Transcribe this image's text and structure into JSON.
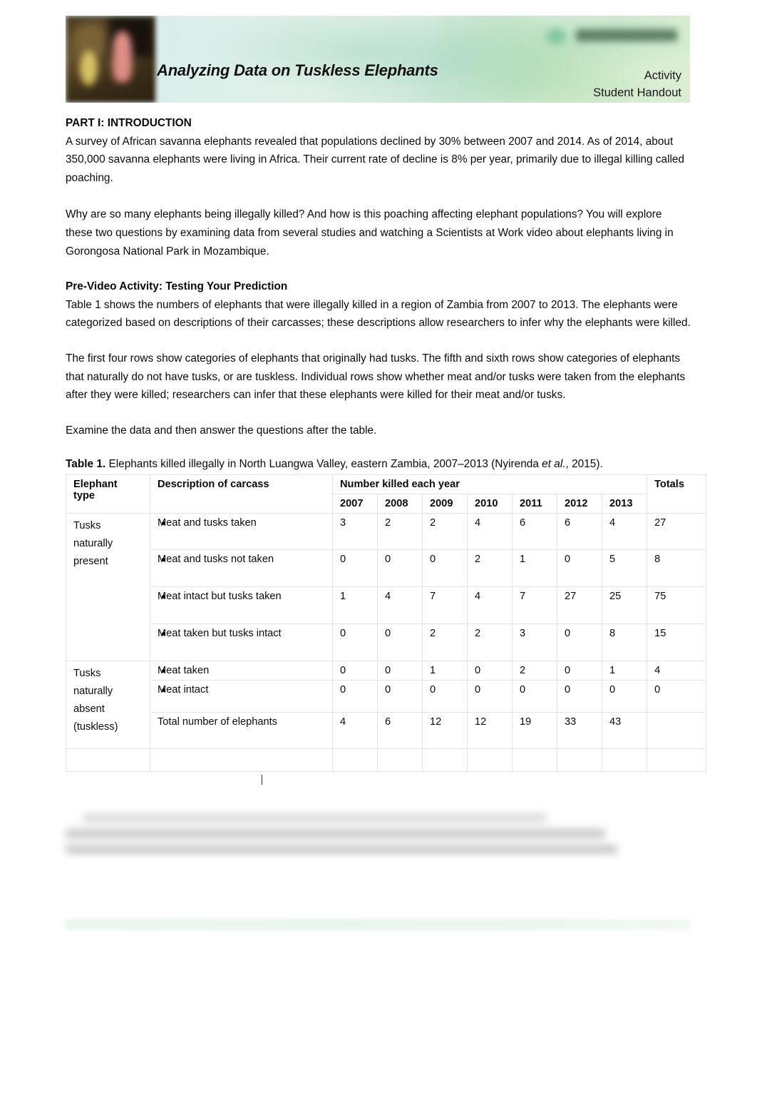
{
  "header": {
    "title": "Analyzing Data on Tuskless Elephants",
    "doc_type": "Activity",
    "audience": "Student Handout",
    "logo_alt": "gorongosa-logo",
    "banner_color": "#d9eee0"
  },
  "sections": {
    "part1_heading": "PART I: INTRODUCTION",
    "para1": "A survey of African savanna elephants revealed that populations declined by 30% between 2007 and 2014. As of 2014, about 350,000 savanna elephants were living in Africa. Their current rate of decline is 8% per year, primarily due to illegal killing called poaching.",
    "para2": "Why are so many elephants being illegally killed? And how is this poaching affecting elephant populations? You will explore these two questions by examining data from several studies and watching a Scientists at Work video about elephants living in Gorongosa National Park in Mozambique.",
    "prevideo_heading": "Pre-Video Activity: Testing Your Prediction",
    "para3": "Table 1 shows the numbers of elephants that were illegally killed in a region of Zambia from 2007 to 2013. The elephants were categorized based on descriptions of their carcasses; these descriptions allow researchers to infer why the elephants were killed.",
    "para4": "The first four rows show categories of elephants that originally had tusks. The fifth and sixth rows show categories of elephants that naturally do not have tusks, or are tuskless. Individual rows show whether meat and/or tusks were taken from the elephants after they were killed; researchers can infer that these elephants were killed for their meat and/or tusks.",
    "para5": "Examine the data and then answer the questions after the table."
  },
  "table": {
    "caption_label": "Table 1.",
    "caption_text_a": " Elephants killed illegally in North Luangwa Valley, eastern Zambia, 2007–2013 (Nyirenda ",
    "caption_italic": "et al.",
    "caption_text_b": ", 2015).",
    "headers": {
      "elephant_type_line1": "Elephant",
      "elephant_type_line2": "type",
      "description": "Description of carcass",
      "number_killed": "Number killed each year",
      "totals": "Totals",
      "years": [
        "2007",
        "2008",
        "2009",
        "2010",
        "2011",
        "2012",
        "2013"
      ]
    },
    "groups": [
      {
        "type_label_lines": [
          "Tusks",
          "naturally",
          "present"
        ],
        "rows": [
          {
            "description": "Meat and tusks taken",
            "values": [
              "3",
              "2",
              "2",
              "4",
              "6",
              "6",
              "4"
            ],
            "total": "27"
          },
          {
            "description": "Meat and tusks not taken",
            "values": [
              "0",
              "0",
              "0",
              "2",
              "1",
              "0",
              "5"
            ],
            "total": "8"
          },
          {
            "description": "Meat intact but tusks taken",
            "values": [
              "1",
              "4",
              "7",
              "4",
              "7",
              "27",
              "25"
            ],
            "total": "75"
          },
          {
            "description": "Meat taken but tusks intact",
            "values": [
              "0",
              "0",
              "2",
              "2",
              "3",
              "0",
              "8"
            ],
            "total": "15"
          }
        ]
      },
      {
        "type_label_lines": [
          "Tusks",
          "naturally",
          "absent",
          "(tuskless)"
        ],
        "rows": [
          {
            "description": "Meat taken",
            "values": [
              "0",
              "0",
              "1",
              "0",
              "2",
              "0",
              "1"
            ],
            "total": "4"
          },
          {
            "description": "Meat intact",
            "values": [
              "0",
              "0",
              "0",
              "0",
              "0",
              "0",
              "0"
            ],
            "total": "0"
          }
        ]
      }
    ],
    "total_row": {
      "description": "Total number of elephants",
      "values": [
        "4",
        "6",
        "12",
        "12",
        "19",
        "33",
        "43"
      ],
      "total": ""
    }
  },
  "chart_data": {
    "type": "table",
    "title": "Elephants killed illegally in North Luangwa Valley, eastern Zambia, 2007–2013 (Nyirenda et al., 2015)",
    "categories": [
      "2007",
      "2008",
      "2009",
      "2010",
      "2011",
      "2012",
      "2013"
    ],
    "xlabel": "Year",
    "ylabel": "Number killed each year",
    "series": [
      {
        "name": "Tusks naturally present — Meat and tusks taken",
        "values": [
          3,
          2,
          2,
          4,
          6,
          6,
          4
        ],
        "total": 27
      },
      {
        "name": "Tusks naturally present — Meat and tusks not taken",
        "values": [
          0,
          0,
          0,
          2,
          1,
          0,
          5
        ],
        "total": 8
      },
      {
        "name": "Tusks naturally present — Meat intact but tusks taken",
        "values": [
          1,
          4,
          7,
          4,
          7,
          27,
          25
        ],
        "total": 75
      },
      {
        "name": "Tusks naturally present — Meat taken but tusks intact",
        "values": [
          0,
          0,
          2,
          2,
          3,
          0,
          8
        ],
        "total": 15
      },
      {
        "name": "Tusks naturally absent (tuskless) — Meat taken",
        "values": [
          0,
          0,
          1,
          0,
          2,
          0,
          1
        ],
        "total": 4
      },
      {
        "name": "Tusks naturally absent (tuskless) — Meat intact",
        "values": [
          0,
          0,
          0,
          0,
          0,
          0,
          0
        ],
        "total": 0
      },
      {
        "name": "Total number of elephants",
        "values": [
          4,
          6,
          12,
          12,
          19,
          33,
          43
        ],
        "total": null
      }
    ],
    "grid": true,
    "legend": "none"
  }
}
